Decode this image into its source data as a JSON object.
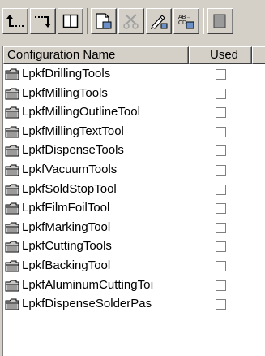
{
  "toolbar": {
    "buttons": [
      {
        "icon": "move-up-level-icon"
      },
      {
        "icon": "move-down-level-icon"
      },
      {
        "icon": "split-view-icon"
      },
      {
        "icon": "new-document-icon"
      },
      {
        "icon": "cut-disabled-icon"
      },
      {
        "icon": "edit-pencil-icon"
      },
      {
        "icon": "rename-ab-icon",
        "text": "AB→ CD"
      },
      {
        "icon": "partial-tool-icon"
      }
    ]
  },
  "list": {
    "columns": [
      {
        "label": "Configuration Name"
      },
      {
        "label": "Used"
      },
      {
        "label": ""
      }
    ],
    "rows": [
      {
        "name": "LpkfDrillingTools",
        "used": false
      },
      {
        "name": "LpkfMillingTools",
        "used": false
      },
      {
        "name": "LpkfMillingOutlineTool",
        "used": false
      },
      {
        "name": "LpkfMillingTextTool",
        "used": false
      },
      {
        "name": "LpkfDispenseTools",
        "used": false
      },
      {
        "name": "LpkfVacuumTools",
        "used": false
      },
      {
        "name": "LpkfSoldStopTool",
        "used": false
      },
      {
        "name": "LpkfFilmFoilTool",
        "used": false
      },
      {
        "name": "LpkfMarkingTool",
        "used": false
      },
      {
        "name": "LpkfCuttingTools",
        "used": false
      },
      {
        "name": "LpkfBackingTool",
        "used": false
      },
      {
        "name": "LpkfAluminumCuttingToı",
        "used": false
      },
      {
        "name": "LpkfDispenseSolderPas",
        "used": false
      }
    ]
  },
  "colors": {
    "face": "#d4d0c8",
    "shadow": "#808080",
    "highlight": "#ffffff",
    "folder": "#c8c8c8"
  }
}
